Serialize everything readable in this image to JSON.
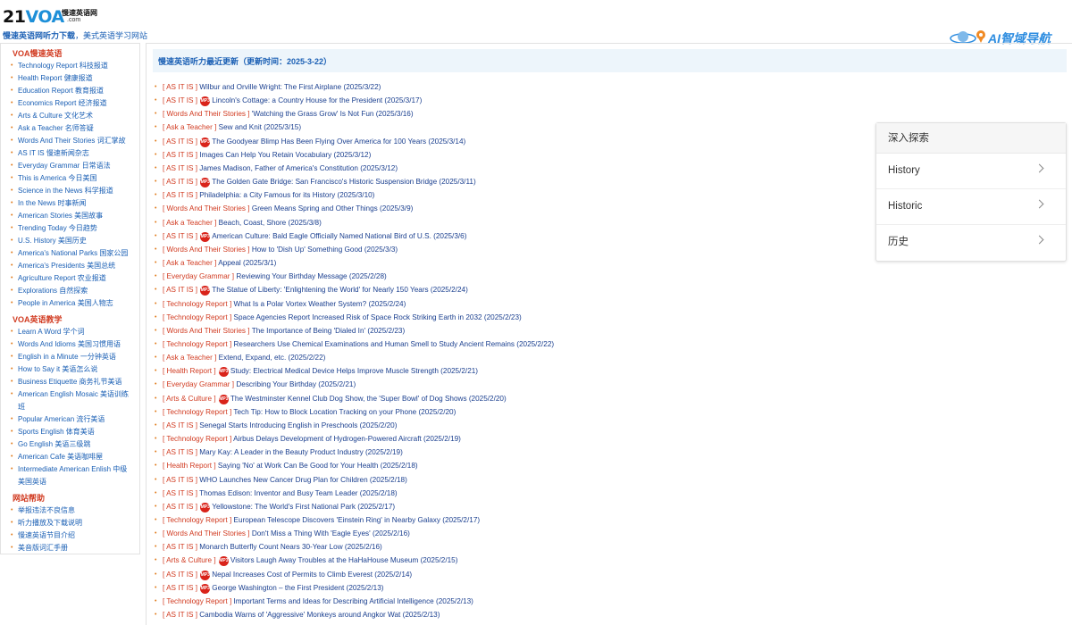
{
  "site": {
    "logo_main": "21",
    "logo_voa": "VOA",
    "logo_cn": "慢速英语网",
    "logo_com": ".com",
    "tagline_bold": "慢速英语网听力下载",
    "tagline_rest": "，美式英语学习网站",
    "ai_badge": "AI智域导航"
  },
  "sidebar": {
    "sections": [
      {
        "title": "VOA慢速英语",
        "items": [
          "Technology Report 科技报道",
          "Health Report 健康报道",
          "Education Report 教育报道",
          "Economics Report 经济报道",
          "Arts & Culture 文化艺术",
          "Ask a Teacher 名师答疑",
          "Words And Their Stories 词汇掌故",
          "AS IT IS 慢速新闻杂志",
          "Everyday Grammar 日常语法",
          "This is America 今日美国",
          "Science in the News 科学报道",
          "In the News 时事新闻",
          "American Stories 美国故事",
          "Trending Today 今日趋势",
          "U.S. History 美国历史",
          "America's National Parks 国家公园",
          "America's Presidents 美国总统",
          "Agriculture Report 农业报道",
          "Explorations 自然探索",
          "People in America 美国人物志"
        ]
      },
      {
        "title": "VOA英语教学",
        "items": [
          "Learn A Word 学个词",
          "Words And Idioms 美国习惯用语",
          "English in a Minute 一分钟英语",
          "How to Say it 美语怎么说",
          "Business Etiquette 商务礼节美语",
          "American English Mosaic 美语训练班",
          "Popular American 流行美语",
          "Sports English 体育美语",
          "Go English 美语三级跳",
          "American Cafe 美语咖啡屋",
          "Intermediate American Enlish 中级美国英语"
        ]
      },
      {
        "title": "网站帮助",
        "items": [
          "举报违法不良信息",
          "听力播放及下载说明",
          "慢速英语节目介绍",
          "美音版词汇手册"
        ]
      }
    ]
  },
  "main": {
    "header": "慢速英语听力最近更新（更新时间：2025-3-22）",
    "mp3_label": "MP3",
    "news": [
      {
        "cat": "[ AS IT IS ]",
        "title": "Wilbur and Orville Wright: The First Airplane (2025/3/22)",
        "mp3": false
      },
      {
        "cat": "[ AS IT IS ]",
        "title": "Lincoln's Cottage: a Country House for the President (2025/3/17)",
        "mp3": true
      },
      {
        "cat": "[ Words And Their Stories ]",
        "title": "'Watching the Grass Grow' Is Not Fun (2025/3/16)",
        "mp3": false
      },
      {
        "cat": "[ Ask a Teacher ]",
        "title": "Sew and Knit (2025/3/15)",
        "mp3": false
      },
      {
        "cat": "[ AS IT IS ]",
        "title": "The Goodyear Blimp Has Been Flying Over America for 100 Years (2025/3/14)",
        "mp3": true
      },
      {
        "cat": "[ AS IT IS ]",
        "title": "Images Can Help You Retain Vocabulary (2025/3/12)",
        "mp3": false
      },
      {
        "cat": "[ AS IT IS ]",
        "title": "James Madison, Father of America's Constitution (2025/3/12)",
        "mp3": false
      },
      {
        "cat": "[ AS IT IS ]",
        "title": "The Golden Gate Bridge: San Francisco's Historic Suspension Bridge (2025/3/11)",
        "mp3": true
      },
      {
        "cat": "[ AS IT IS ]",
        "title": "Philadelphia: a City Famous for its History (2025/3/10)",
        "mp3": false
      },
      {
        "cat": "[ Words And Their Stories ]",
        "title": "Green Means Spring and Other Things (2025/3/9)",
        "mp3": false
      },
      {
        "cat": "[ Ask a Teacher ]",
        "title": "Beach, Coast, Shore (2025/3/8)",
        "mp3": false
      },
      {
        "cat": "[ AS IT IS ]",
        "title": "American Culture: Bald Eagle Officially Named National Bird of U.S. (2025/3/6)",
        "mp3": true
      },
      {
        "cat": "[ Words And Their Stories ]",
        "title": "How to 'Dish Up' Something Good (2025/3/3)",
        "mp3": false
      },
      {
        "cat": "[ Ask a Teacher ]",
        "title": "Appeal (2025/3/1)",
        "mp3": false
      },
      {
        "cat": "[ Everyday Grammar ]",
        "title": "Reviewing Your Birthday Message (2025/2/28)",
        "mp3": false
      },
      {
        "cat": "[ AS IT IS ]",
        "title": "The Statue of Liberty: 'Enlightening the World' for Nearly 150 Years (2025/2/24)",
        "mp3": true
      },
      {
        "cat": "[ Technology Report ]",
        "title": "What Is a Polar Vortex Weather System? (2025/2/24)",
        "mp3": false
      },
      {
        "cat": "[ Technology Report ]",
        "title": "Space Agencies Report Increased Risk of Space Rock Striking Earth in 2032 (2025/2/23)",
        "mp3": false
      },
      {
        "cat": "[ Words And Their Stories ]",
        "title": "The Importance of Being 'Dialed In' (2025/2/23)",
        "mp3": false
      },
      {
        "cat": "[ Technology Report ]",
        "title": "Researchers Use Chemical Examinations and Human Smell to Study Ancient Remains (2025/2/22)",
        "mp3": false
      },
      {
        "cat": "[ Ask a Teacher ]",
        "title": "Extend, Expand, etc. (2025/2/22)",
        "mp3": false
      },
      {
        "cat": "[ Health Report ]",
        "title": "Study: Electrical Medical Device Helps Improve Muscle Strength (2025/2/21)",
        "mp3": true
      },
      {
        "cat": "[ Everyday Grammar ]",
        "title": "Describing Your Birthday (2025/2/21)",
        "mp3": false
      },
      {
        "cat": "[ Arts & Culture ]",
        "title": "The Westminster Kennel Club Dog Show, the 'Super Bowl' of Dog Shows (2025/2/20)",
        "mp3": true
      },
      {
        "cat": "[ Technology Report ]",
        "title": "Tech Tip: How to Block Location Tracking on your Phone (2025/2/20)",
        "mp3": false
      },
      {
        "cat": "[ AS IT IS ]",
        "title": "Senegal Starts Introducing English in Preschools (2025/2/20)",
        "mp3": false
      },
      {
        "cat": "[ Technology Report ]",
        "title": "Airbus Delays Development of Hydrogen-Powered Aircraft (2025/2/19)",
        "mp3": false
      },
      {
        "cat": "[ AS IT IS ]",
        "title": "Mary Kay: A Leader in the Beauty Product Industry (2025/2/19)",
        "mp3": false
      },
      {
        "cat": "[ Health Report ]",
        "title": "Saying 'No' at Work Can Be Good for Your Health (2025/2/18)",
        "mp3": false
      },
      {
        "cat": "[ AS IT IS ]",
        "title": "WHO Launches New Cancer Drug Plan for Children (2025/2/18)",
        "mp3": false
      },
      {
        "cat": "[ AS IT IS ]",
        "title": "Thomas Edison: Inventor and Busy Team Leader (2025/2/18)",
        "mp3": false
      },
      {
        "cat": "[ AS IT IS ]",
        "title": "Yellowstone: The World's First National Park (2025/2/17)",
        "mp3": true
      },
      {
        "cat": "[ Technology Report ]",
        "title": "European Telescope Discovers 'Einstein Ring' in Nearby Galaxy (2025/2/17)",
        "mp3": false
      },
      {
        "cat": "[ Words And Their Stories ]",
        "title": "Don't Miss a Thing With 'Eagle Eyes' (2025/2/16)",
        "mp3": false
      },
      {
        "cat": "[ AS IT IS ]",
        "title": "Monarch Butterfly Count Nears 30-Year Low (2025/2/16)",
        "mp3": false
      },
      {
        "cat": "[ Arts & Culture ]",
        "title": "Visitors Laugh Away Troubles at the HaHaHouse Museum (2025/2/15)",
        "mp3": true
      },
      {
        "cat": "[ AS IT IS ]",
        "title": "Nepal Increases Cost of Permits to Climb Everest (2025/2/14)",
        "mp3": true
      },
      {
        "cat": "[ AS IT IS ]",
        "title": "George Washington – the First President (2025/2/13)",
        "mp3": true
      },
      {
        "cat": "[ Technology Report ]",
        "title": "Important Terms and Ideas for Describing Artificial Intelligence (2025/2/13)",
        "mp3": false
      },
      {
        "cat": "[ AS IT IS ]",
        "title": "Cambodia Warns of 'Aggressive' Monkeys around Angkor Wat (2025/2/13)",
        "mp3": false
      }
    ]
  },
  "explore": {
    "heading": "深入探索",
    "items": [
      "History",
      "Historic",
      "历史"
    ]
  },
  "colors": {
    "link": "#1a3f8f",
    "category": "#d13b21",
    "accent": "#1d8fd8"
  }
}
